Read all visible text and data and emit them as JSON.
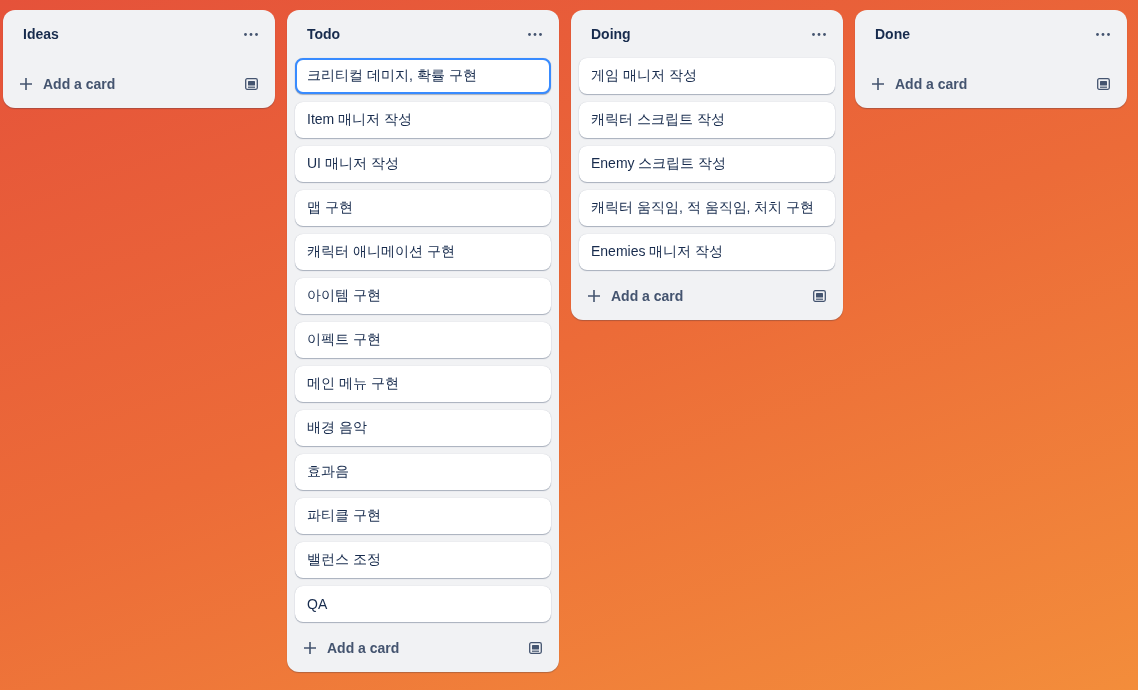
{
  "lists": [
    {
      "title": "Ideas",
      "add_label": "Add a card"
    },
    {
      "title": "Todo",
      "cards": [
        {
          "text": "크리티컬 데미지, 확률 구현",
          "selected": true
        },
        {
          "text": "Item 매니저 작성",
          "selected": false
        },
        {
          "text": "UI 매니저 작성",
          "selected": false
        },
        {
          "text": "맵 구현",
          "selected": false
        },
        {
          "text": "캐릭터 애니메이션 구현",
          "selected": false
        },
        {
          "text": "아이템 구현",
          "selected": false
        },
        {
          "text": "이펙트 구현",
          "selected": false
        },
        {
          "text": "메인 메뉴 구현",
          "selected": false
        },
        {
          "text": "배경 음악",
          "selected": false
        },
        {
          "text": "효과음",
          "selected": false
        },
        {
          "text": "파티클 구현",
          "selected": false
        },
        {
          "text": "밸런스 조정",
          "selected": false
        },
        {
          "text": "QA",
          "selected": false
        }
      ],
      "add_label": "Add a card"
    },
    {
      "title": "Doing",
      "cards": [
        {
          "text": "게임 매니저 작성",
          "selected": false
        },
        {
          "text": "캐릭터 스크립트 작성",
          "selected": false
        },
        {
          "text": "Enemy 스크립트 작성",
          "selected": false
        },
        {
          "text": "캐릭터 움직임, 적 움직임, 처치 구현",
          "selected": false
        },
        {
          "text": "Enemies 매니저 작성",
          "selected": false
        }
      ],
      "add_label": "Add a card"
    },
    {
      "title": "Done",
      "add_label": "Add a card"
    }
  ]
}
